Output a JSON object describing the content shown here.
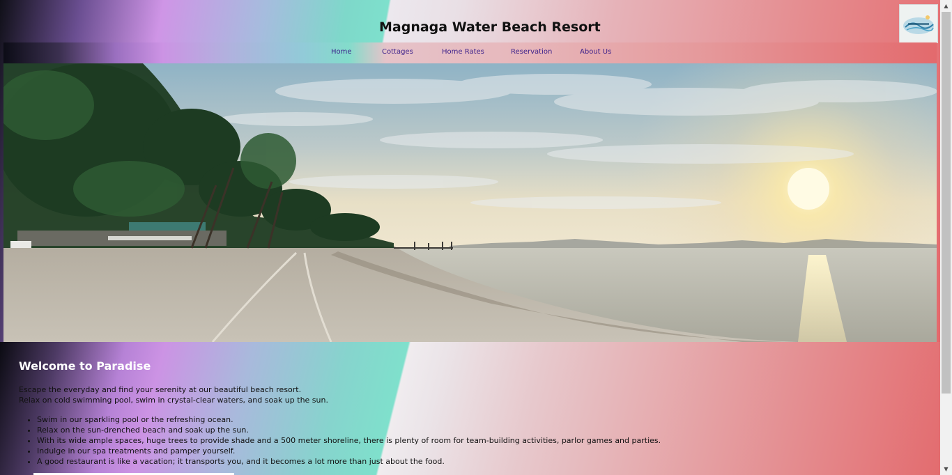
{
  "header": {
    "title": "Magnaga Water Beach Resort",
    "logo_icon": "resort-logo-icon"
  },
  "nav": {
    "items": [
      {
        "label": "Home"
      },
      {
        "label": "Cottages"
      },
      {
        "label": "Home Rates"
      },
      {
        "label": "Reservation"
      },
      {
        "label": "About Us"
      }
    ],
    "text_color": "#3a1f8a"
  },
  "hero": {
    "icon": "beach-sunset-photo"
  },
  "content": {
    "heading": "Welcome to Paradise",
    "intro_lines": [
      "Escape the everyday and find your serenity at our beautiful beach resort.",
      "Relax on cold swimming pool, swim in crystal-clear waters, and soak up the sun."
    ],
    "features": [
      "Swim in our sparkling pool or the refreshing ocean.",
      "Relax on the sun-drenched beach and soak up the sun.",
      "With its wide ample spaces, huge trees to provide shade and a 500 meter shoreline, there is plenty of room for team-building activities, parlor games and parties.",
      "Indulge in our spa treatments and pamper yourself.",
      "A good restaurant is like a vacation; it transports you, and it becomes a lot more than just about the food."
    ]
  },
  "colors": {
    "gradient_purple": "#cc93e4",
    "gradient_teal": "#7fe0cc",
    "gradient_red": "#e36c6f",
    "heading_color": "#ffffff"
  },
  "scrollbar": {
    "up_icon": "scroll-up-arrow-icon",
    "down_icon": "scroll-down-arrow-icon"
  }
}
